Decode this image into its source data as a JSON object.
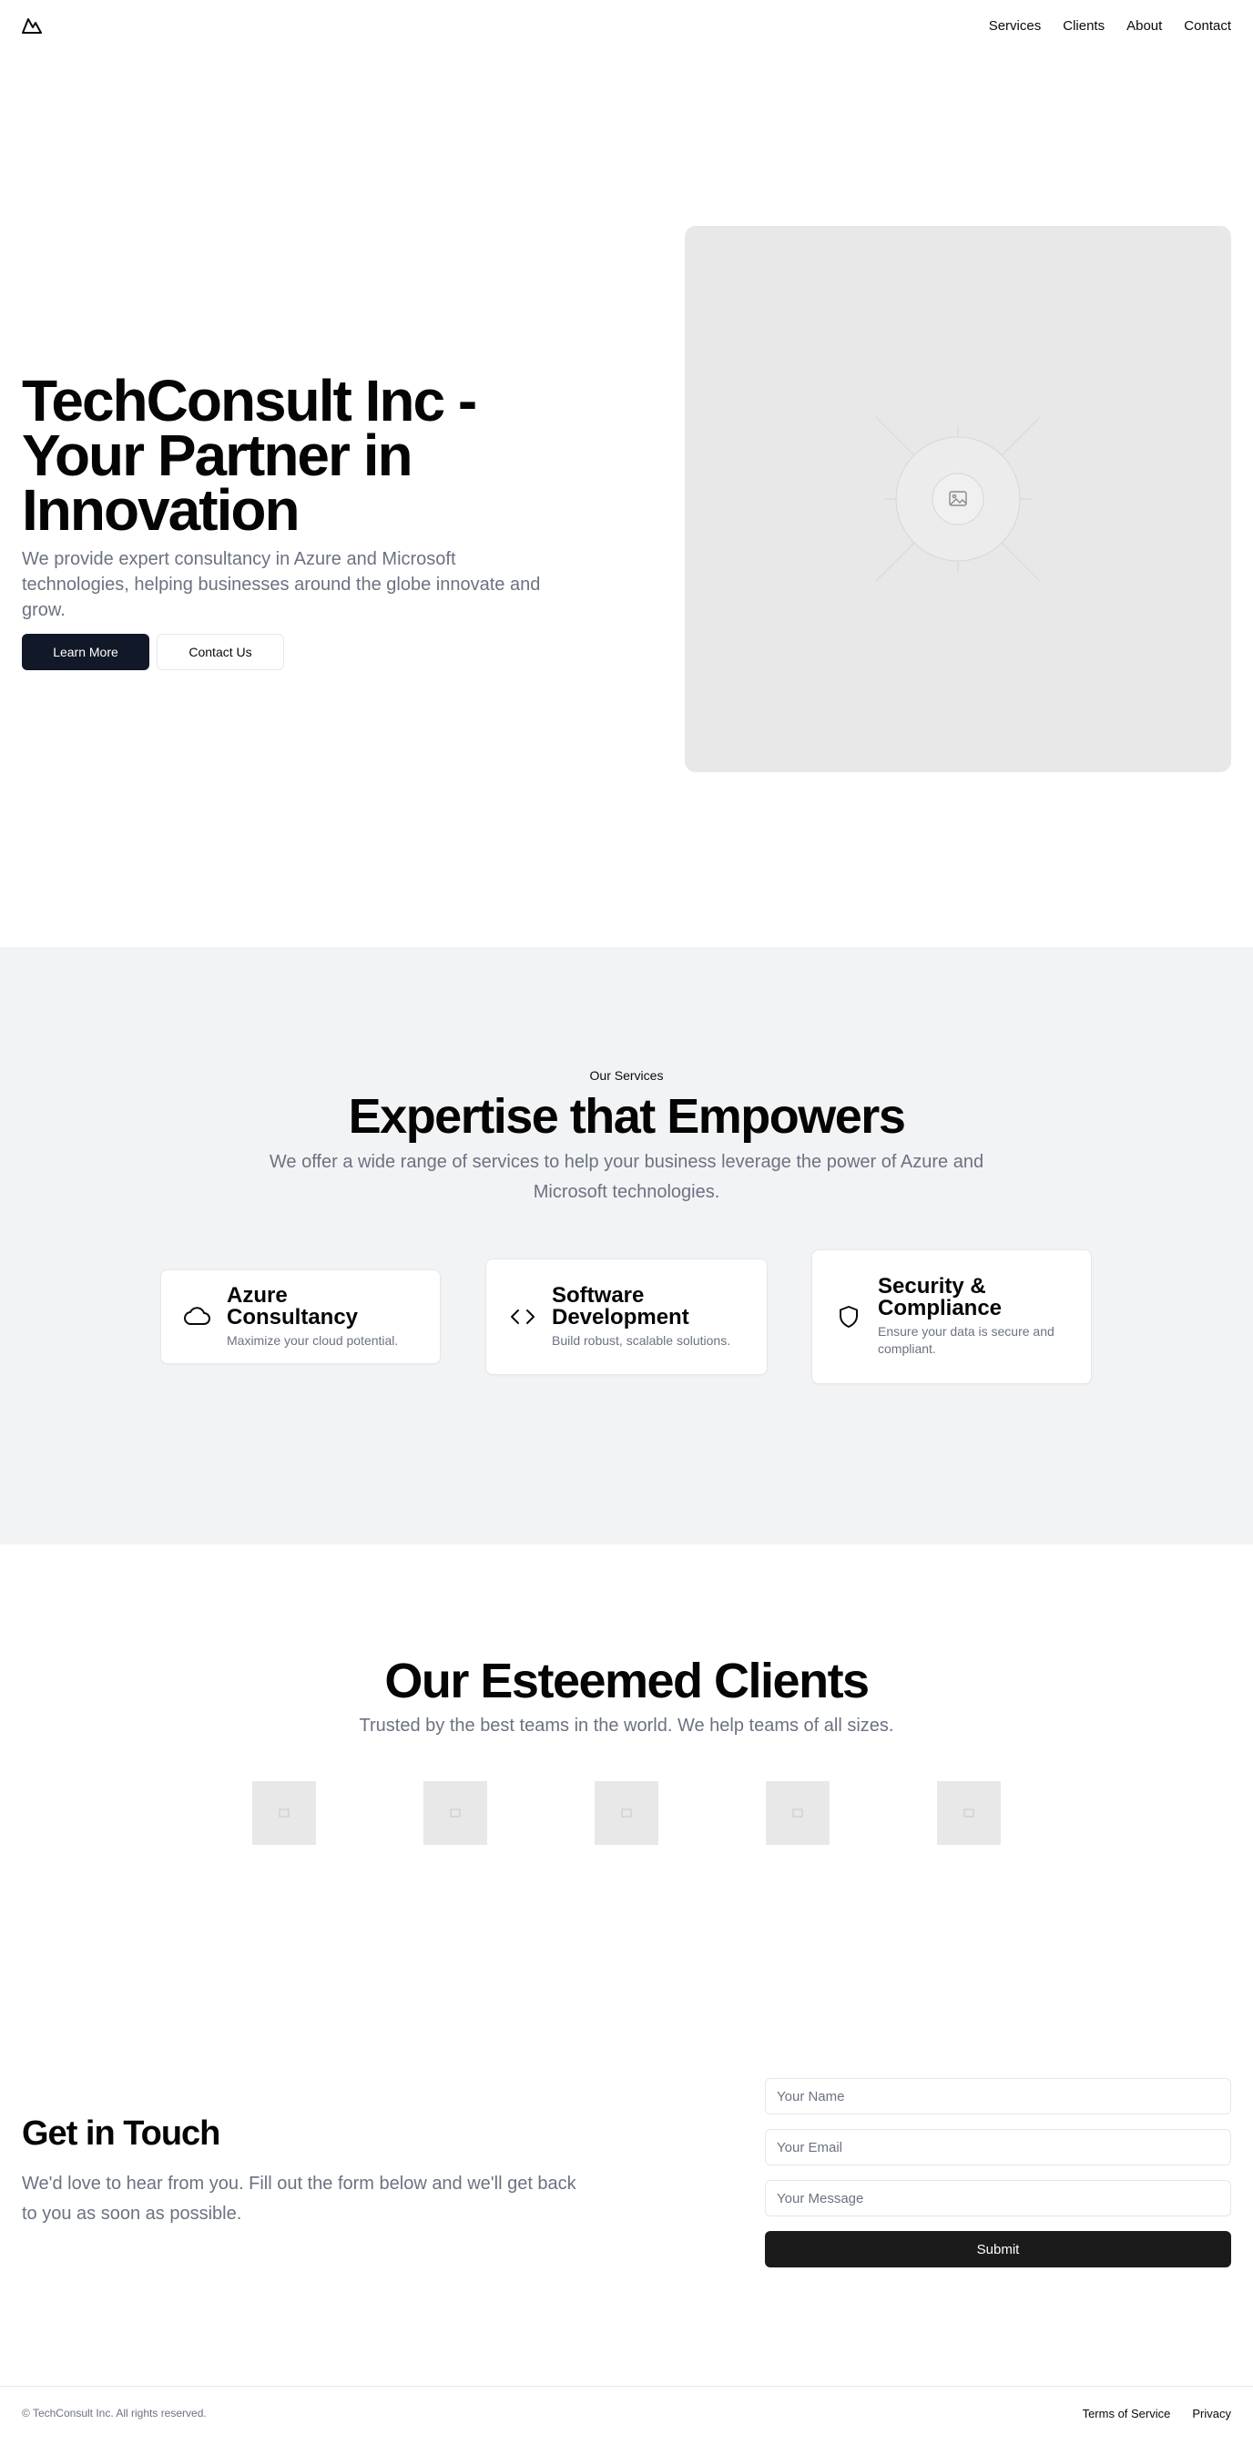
{
  "header": {
    "logo_icon": "mountain-icon",
    "nav": [
      {
        "label": "Services"
      },
      {
        "label": "Clients"
      },
      {
        "label": "About"
      },
      {
        "label": "Contact"
      }
    ]
  },
  "hero": {
    "title": "TechConsult Inc - Your Partner in Innovation",
    "subtitle": "We provide expert consultancy in Azure and Microsoft technologies, helping businesses around the globe innovate and grow.",
    "primary_button": "Learn More",
    "secondary_button": "Contact Us",
    "image_icon": "image-placeholder-icon"
  },
  "services": {
    "eyebrow": "Our Services",
    "title": "Expertise that Empowers",
    "subtitle": "We offer a wide range of services to help your business leverage the power of Azure and Microsoft technologies.",
    "cards": [
      {
        "icon": "cloud-icon",
        "title": "Azure Consultancy",
        "description": "Maximize your cloud potential."
      },
      {
        "icon": "code-icon",
        "title": "Software Development",
        "description": "Build robust, scalable solutions."
      },
      {
        "icon": "shield-icon",
        "title": "Security & Compliance",
        "description": "Ensure your data is secure and compliant."
      }
    ]
  },
  "clients": {
    "title": "Our Esteemed Clients",
    "subtitle": "Trusted by the best teams in the world. We help teams of all sizes.",
    "logo_count": 5
  },
  "contact": {
    "title": "Get in Touch",
    "subtitle": "We'd love to hear from you. Fill out the form below and we'll get back to you as soon as possible.",
    "name_placeholder": "Your Name",
    "email_placeholder": "Your Email",
    "message_placeholder": "Your Message",
    "submit_label": "Submit"
  },
  "footer": {
    "copyright": "© TechConsult Inc. All rights reserved.",
    "links": [
      {
        "label": "Terms of Service"
      },
      {
        "label": "Privacy"
      }
    ]
  }
}
